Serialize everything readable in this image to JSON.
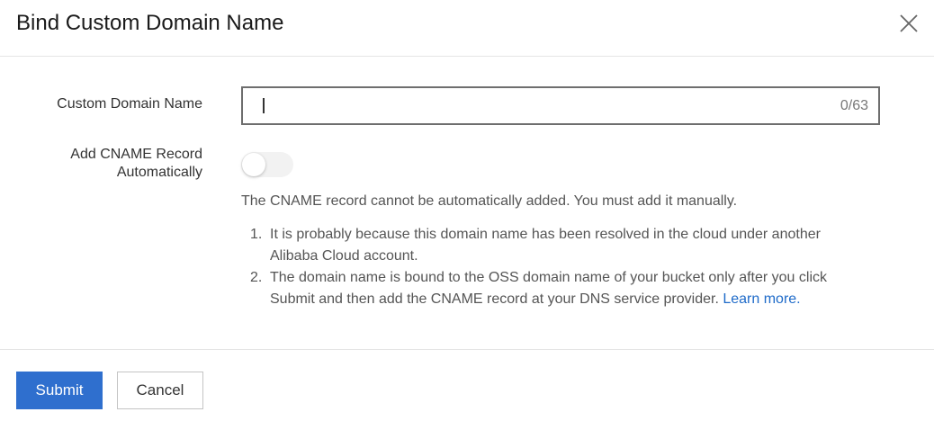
{
  "dialog": {
    "title": "Bind Custom Domain Name",
    "close_icon": "close-icon"
  },
  "form": {
    "domain_label": "Custom Domain Name",
    "domain_value": "",
    "domain_counter": "0/63",
    "cname_label_line1": "Add CNAME Record",
    "cname_label_line2": "Automatically",
    "cname_enabled": false
  },
  "notice": {
    "text": "The CNAME record cannot be automatically added. You must add it manually.",
    "items": [
      {
        "num": "1.",
        "text": "It is probably because this domain name has been resolved in the cloud under another Alibaba Cloud account."
      },
      {
        "num": "2.",
        "text": "The domain name is bound to the OSS domain name of your bucket only after you click Submit and then add the CNAME record at your DNS service provider. ",
        "link": "Learn more."
      }
    ]
  },
  "footer": {
    "submit_label": "Submit",
    "cancel_label": "Cancel"
  },
  "colors": {
    "primary": "#2f6fce",
    "link": "#1f6bc9",
    "border": "#6e6e6e"
  }
}
